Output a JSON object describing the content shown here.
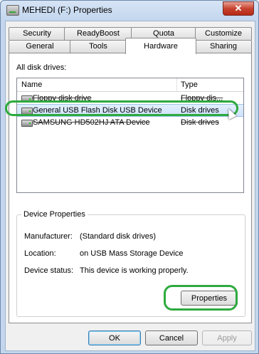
{
  "window": {
    "title": "MEHEDI (F:) Properties",
    "close_glyph": "✕"
  },
  "tabs": {
    "back_row": [
      "Security",
      "ReadyBoost",
      "Quota",
      "Customize"
    ],
    "front_row": [
      "General",
      "Tools",
      "Hardware",
      "Sharing"
    ],
    "active": "Hardware"
  },
  "hardware": {
    "all_disks_label": "All disk drives:",
    "columns": {
      "name": "Name",
      "type": "Type"
    },
    "drives": [
      {
        "name": "Floppy disk drive",
        "type": "Floppy dis...",
        "icon": "floppy-drive-icon"
      },
      {
        "name": "General USB Flash Disk USB Device",
        "type": "Disk drives",
        "icon": "usb-drive-icon",
        "selected": true
      },
      {
        "name": "SAMSUNG HD502HJ ATA Device",
        "type": "Disk drives",
        "icon": "hard-drive-icon"
      }
    ],
    "device_properties": {
      "legend": "Device Properties",
      "manufacturer_label": "Manufacturer:",
      "manufacturer_value": "(Standard disk drives)",
      "location_label": "Location:",
      "location_value": "on USB Mass Storage Device",
      "status_label": "Device status:",
      "status_value": "This device is working properly."
    },
    "properties_button": "Properties"
  },
  "dialog_buttons": {
    "ok": "OK",
    "cancel": "Cancel",
    "apply": "Apply"
  },
  "colors": {
    "highlight": "#2daa3e",
    "selection": "#cfe3fb"
  }
}
